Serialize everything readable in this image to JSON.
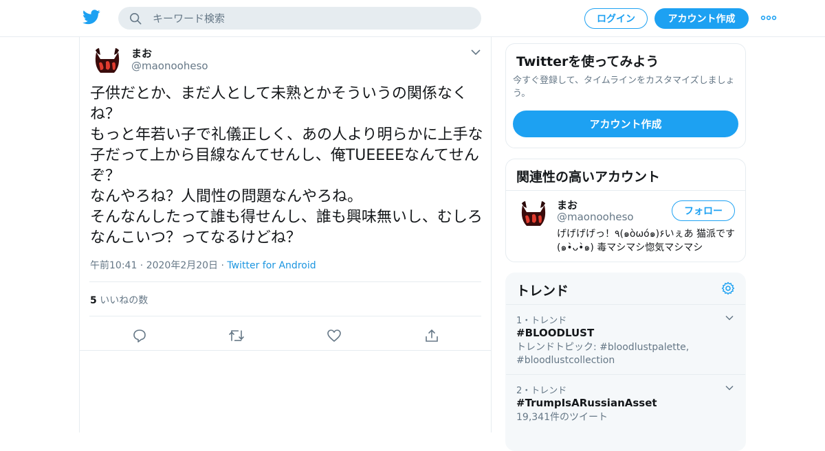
{
  "header": {
    "search_placeholder": "キーワード検索",
    "login_label": "ログイン",
    "signup_label": "アカウント作成",
    "brand_color": "#1da1f2"
  },
  "tweet": {
    "author_name": "まお",
    "author_handle": "@maonooheso",
    "text": "子供だとか、まだ人として未熟とかそういうの関係なくね？\nもっと年若い子で礼儀正しく、あの人より明らかに上手な子だって上から目線なんてせんし、俺TUEEEEなんてせんぞ？\nなんやろね？人間性の問題なんやろね。\nそんなんしたって誰も得せんし、誰も興味無いし、むしろなんこいつ？ってなるけどね？",
    "time": "午前10:41 · 2020年2月20日",
    "separator": " · ",
    "source": "Twitter for Android",
    "likes_count": "5",
    "likes_label": "いいねの数"
  },
  "signup_card": {
    "title": "Twitterを使ってみよう",
    "description": "今すぐ登録して、タイムラインをカスタマイズしましょう。",
    "button_label": "アカウント作成"
  },
  "related_card": {
    "title": "関連性の高いアカウント",
    "name": "まお",
    "handle": "@maonooheso",
    "follow_label": "フォロー",
    "bio": "げげげげっ！٩(๑òωó๑)۶いぇあ 猫派です(๑•̀ᴗ•̀๑) 毒マシマシ惚気マシマシ"
  },
  "trends": {
    "title": "トレンド",
    "items": [
      {
        "rank": "1・トレンド",
        "name": "#BLOODLUST",
        "sub": "トレンドトピック: #bloodlustpalette, #bloodlustcollection"
      },
      {
        "rank": "2・トレンド",
        "name": "#TrumpIsARussianAsset",
        "sub": "19,341件のツイート"
      }
    ]
  }
}
